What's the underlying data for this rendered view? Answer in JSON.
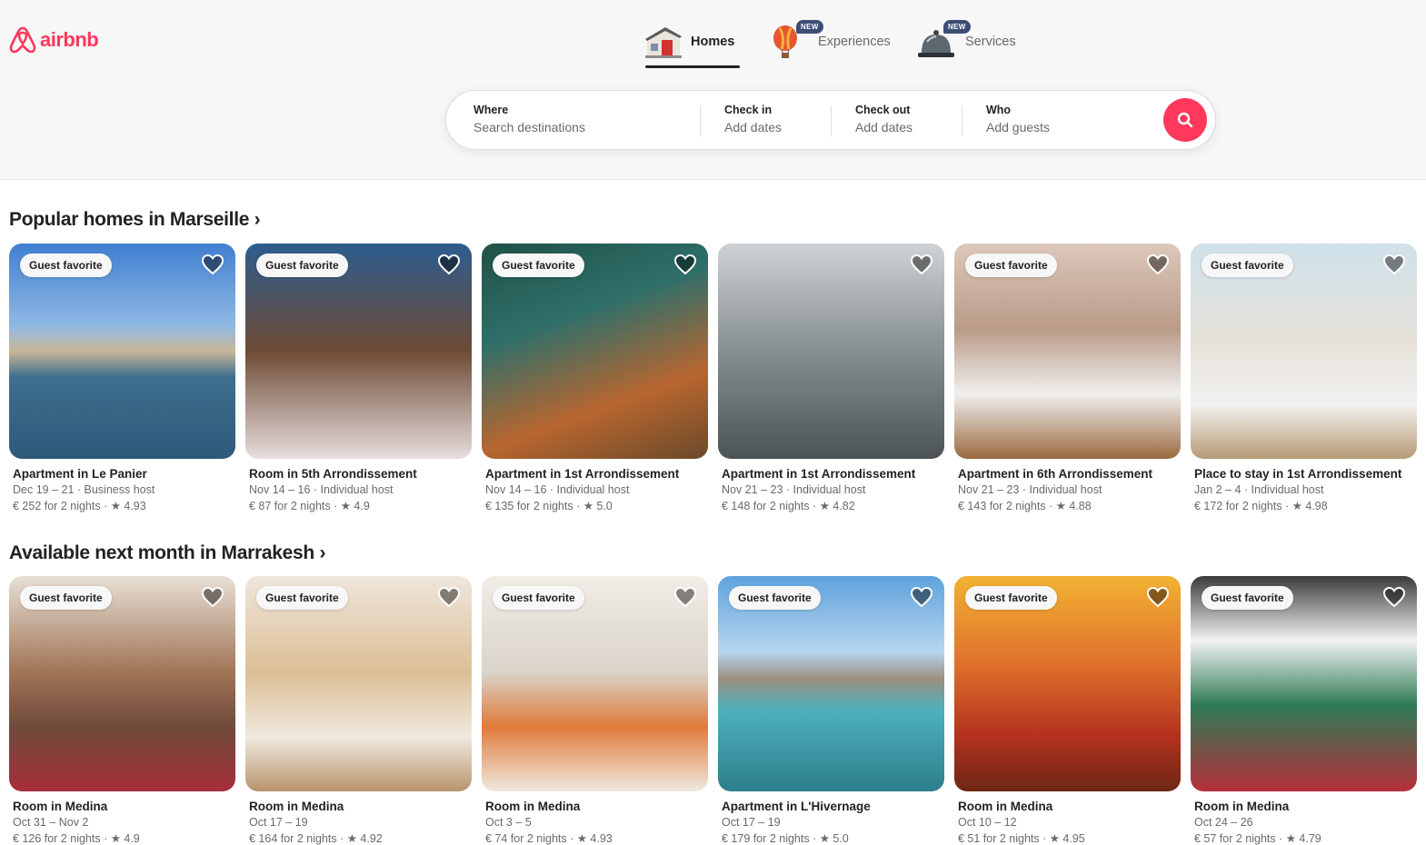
{
  "brand": {
    "name": "airbnb",
    "color": "#ff385c"
  },
  "nav": {
    "tabs": [
      {
        "label": "Homes",
        "icon": "house-icon",
        "active": true,
        "badge": ""
      },
      {
        "label": "Experiences",
        "icon": "hot-air-balloon-icon",
        "active": false,
        "badge": "NEW"
      },
      {
        "label": "Services",
        "icon": "service-bell-icon",
        "active": false,
        "badge": "NEW"
      }
    ]
  },
  "search": {
    "where": {
      "title": "Where",
      "placeholder": "Search destinations"
    },
    "checkin": {
      "title": "Check in",
      "placeholder": "Add dates"
    },
    "checkout": {
      "title": "Check out",
      "placeholder": "Add dates"
    },
    "who": {
      "title": "Who",
      "placeholder": "Add guests"
    },
    "button_icon": "search-icon"
  },
  "sections": [
    {
      "title": "Popular homes in Marseille ›",
      "listings": [
        {
          "badge": "Guest favorite",
          "title": "Apartment in Le Panier",
          "dates": "Dec 19 – 21 · Business host",
          "price": "€ 252 for 2 nights · ★ 4.93"
        },
        {
          "badge": "Guest favorite",
          "title": "Room in 5th Arrondissement",
          "dates": "Nov 14 – 16 · Individual host",
          "price": "€ 87 for 2 nights · ★ 4.9"
        },
        {
          "badge": "Guest favorite",
          "title": "Apartment in 1st Arrondissement",
          "dates": "Nov 14 – 16 · Individual host",
          "price": "€ 135 for 2 nights · ★ 5.0"
        },
        {
          "badge": "",
          "title": "Apartment in 1st Arrondissement",
          "dates": "Nov 21 – 23 · Individual host",
          "price": "€ 148 for 2 nights · ★ 4.82"
        },
        {
          "badge": "Guest favorite",
          "title": "Apartment in 6th Arrondissement",
          "dates": "Nov 21 – 23 · Individual host",
          "price": "€ 143 for 2 nights · ★ 4.88"
        },
        {
          "badge": "Guest favorite",
          "title": "Place to stay in 1st Arrondissement",
          "dates": "Jan 2 – 4 · Individual host",
          "price": "€ 172 for 2 nights · ★ 4.98"
        }
      ]
    },
    {
      "title": "Available next month in Marrakesh ›",
      "listings": [
        {
          "badge": "Guest favorite",
          "title": "Room in Medina",
          "dates": "Oct 31 – Nov 2",
          "price": "€ 126 for 2 nights · ★ 4.9"
        },
        {
          "badge": "Guest favorite",
          "title": "Room in Medina",
          "dates": "Oct 17 – 19",
          "price": "€ 164 for 2 nights · ★ 4.92"
        },
        {
          "badge": "Guest favorite",
          "title": "Room in Medina",
          "dates": "Oct 3 – 5",
          "price": "€ 74 for 2 nights · ★ 4.93"
        },
        {
          "badge": "Guest favorite",
          "title": "Apartment in L'Hivernage",
          "dates": "Oct 17 – 19",
          "price": "€ 179 for 2 nights · ★ 5.0"
        },
        {
          "badge": "Guest favorite",
          "title": "Room in Medina",
          "dates": "Oct 10 – 12",
          "price": "€ 51 for 2 nights · ★ 4.95"
        },
        {
          "badge": "Guest favorite",
          "title": "Room in Medina",
          "dates": "Oct 24 – 26",
          "price": "€ 57 for 2 nights · ★ 4.79"
        }
      ]
    }
  ]
}
